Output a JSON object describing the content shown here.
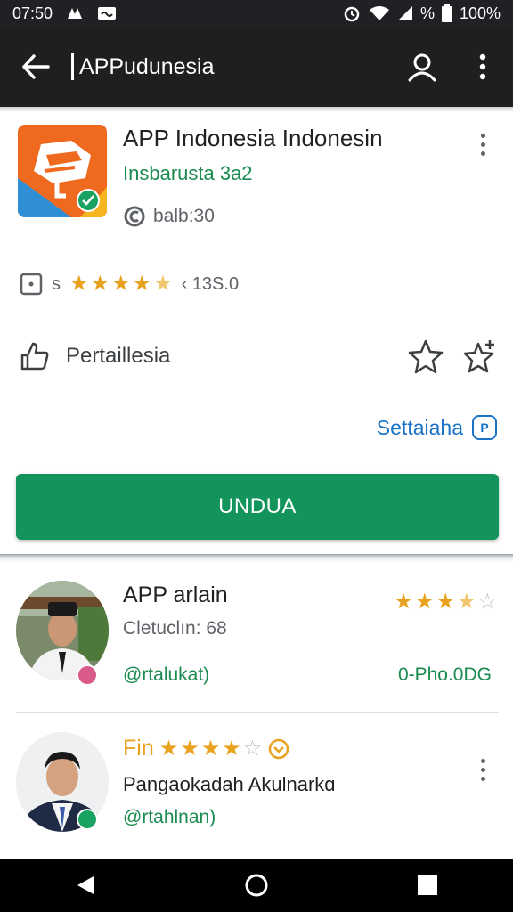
{
  "status_bar": {
    "time": "07:50",
    "battery_text": "100%",
    "percent_icon_text": "%"
  },
  "app_bar": {
    "title": "APPudunesia"
  },
  "app": {
    "title": "APP Indonesia Indonesin",
    "developer": "Insbarusta 3a2",
    "meta": "balb:30",
    "rating_prefix": "s",
    "rating_stars": 4.5,
    "rating_count": "‹ 13S.0",
    "feature_label": "Pertaillesia",
    "settings_label": "Settaiaha",
    "settings_badge": "P",
    "install_label": "UNDUA"
  },
  "items": [
    {
      "title": "APP arlain",
      "subtitle": "Cletuclın: 68",
      "link": "@rtalukat)",
      "price": "0-Pho.0DG",
      "stars": 3.5
    },
    {
      "title_prefix": "Fin",
      "title_stars": 4,
      "subtitle": "Pangaokadah Akulnarkɑ",
      "link": "@rtahlnan)"
    }
  ],
  "colors": {
    "accent_green": "#12945b",
    "link_green": "#1a8a4f",
    "star_gold": "#e8a21f",
    "link_blue": "#1a73c8"
  }
}
